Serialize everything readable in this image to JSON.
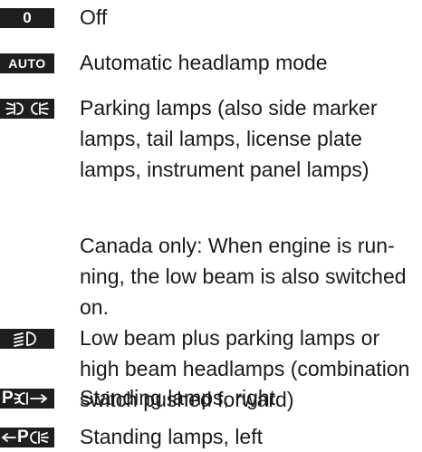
{
  "items": [
    {
      "symbol_text": "0",
      "icon": "zero-position-icon",
      "text": "Off"
    },
    {
      "symbol_text": "AUTO",
      "icon": "auto-headlamp-icon",
      "text": "Automatic headlamp mode"
    },
    {
      "symbol_text": "",
      "icon": "parking-lamps-icon",
      "text": "Parking lamps (also side marker\nlamps, tail lamps, license plate\nlamps, instrument panel lamps)"
    },
    {
      "symbol_text": "",
      "icon": "",
      "text": "Canada only: When engine is run-\nning, the low beam is also switched\non."
    },
    {
      "symbol_text": "",
      "icon": "low-beam-icon",
      "text": "Low beam plus parking lamps or\nhigh beam headlamps (combination\nswitch pushed forward)"
    },
    {
      "symbol_text": "P",
      "icon": "standing-lamps-right-icon",
      "text": "Standing lamps, right"
    },
    {
      "symbol_text": "P",
      "icon": "standing-lamps-left-icon",
      "text": "Standing lamps, left"
    }
  ]
}
